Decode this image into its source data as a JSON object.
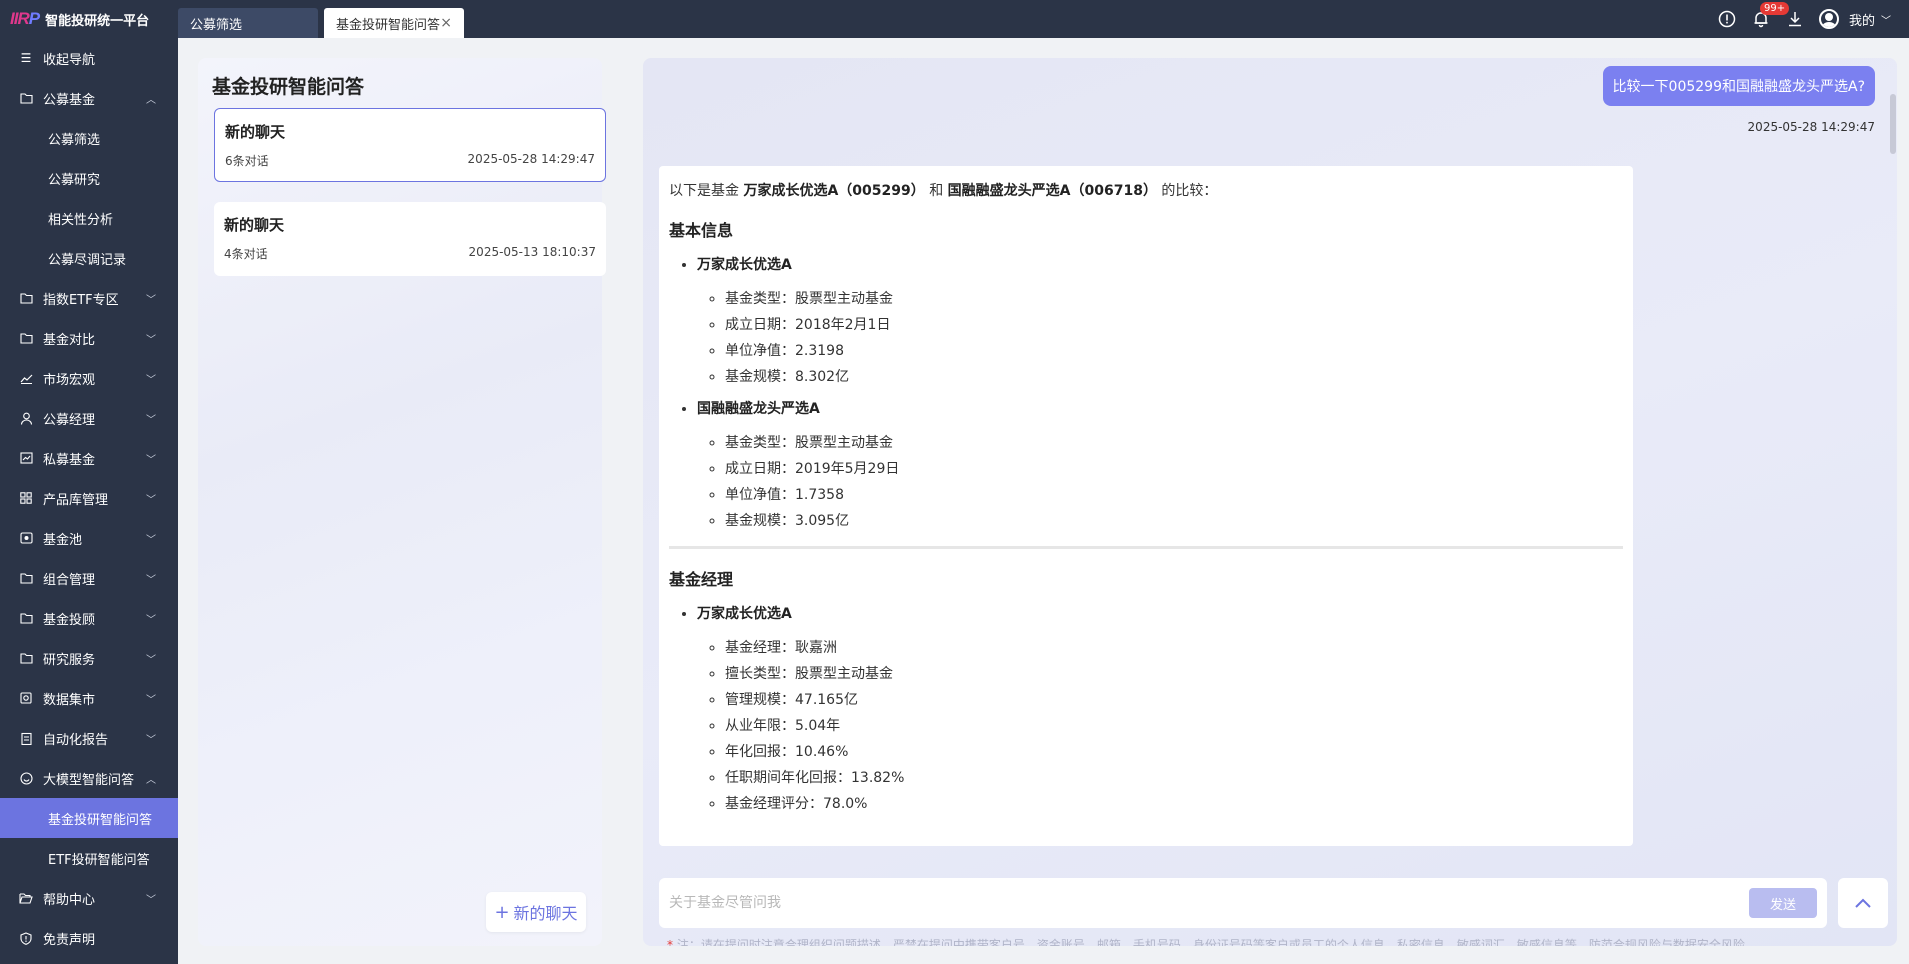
{
  "brand": {
    "logo_a": "IIR",
    "logo_b": "P",
    "title": "智能投研统一平台"
  },
  "tabs": [
    {
      "label": "公募筛选"
    },
    {
      "label": "基金投研智能问答",
      "close": "×"
    }
  ],
  "topbar": {
    "notification_badge": "99+",
    "me_label": "我的"
  },
  "sidebar": {
    "collapse": "收起导航",
    "items": [
      {
        "label": "公募基金",
        "icon": "folder-icon"
      },
      {
        "label": "公募筛选"
      },
      {
        "label": "公募研究"
      },
      {
        "label": "相关性分析"
      },
      {
        "label": "公募尽调记录"
      },
      {
        "label": "指数ETF专区",
        "icon": "folder-icon"
      },
      {
        "label": "基金对比",
        "icon": "folder-icon"
      },
      {
        "label": "市场宏观",
        "icon": "chart-line-icon"
      },
      {
        "label": "公募经理",
        "icon": "user-icon"
      },
      {
        "label": "私募基金",
        "icon": "chart-box-icon"
      },
      {
        "label": "产品库管理",
        "icon": "grid-icon"
      },
      {
        "label": "基金池",
        "icon": "pool-icon"
      },
      {
        "label": "组合管理",
        "icon": "folder-icon"
      },
      {
        "label": "基金投顾",
        "icon": "folder-icon"
      },
      {
        "label": "研究服务",
        "icon": "folder-icon"
      },
      {
        "label": "数据集市",
        "icon": "database-icon"
      },
      {
        "label": "自动化报告",
        "icon": "report-icon"
      },
      {
        "label": "大模型智能问答",
        "icon": "smile-icon"
      },
      {
        "label": "基金投研智能问答"
      },
      {
        "label": "ETF投研智能问答"
      },
      {
        "label": "帮助中心",
        "icon": "folder-open-icon"
      },
      {
        "label": "免责声明",
        "icon": "shield-icon"
      }
    ]
  },
  "left_panel": {
    "title": "基金投研智能问答",
    "chats": [
      {
        "title": "新的聊天",
        "count": "6条对话",
        "time": "2025-05-28 14:29:47"
      },
      {
        "title": "新的聊天",
        "count": "4条对话",
        "time": "2025-05-13 18:10:37"
      }
    ],
    "new_chat": "新的聊天"
  },
  "conversation": {
    "user_message": "比较一下005299和国融融盛龙头严选A?",
    "user_time": "2025-05-28 14:29:47",
    "answer": {
      "intro_prefix": "以下是基金",
      "fund_a_full": "万家成长优选A（005299）",
      "intro_and": "和",
      "fund_b_full": "国融融盛龙头严选A（006718）",
      "intro_suffix": "的比较：",
      "section_basic": "基本信息",
      "fund_a": "万家成长优选A",
      "fund_a_basic": [
        "基金类型：股票型主动基金",
        "成立日期：2018年2月1日",
        "单位净值：2.3198",
        "基金规模：8.302亿"
      ],
      "fund_b": "国融融盛龙头严选A",
      "fund_b_basic": [
        "基金类型：股票型主动基金",
        "成立日期：2019年5月29日",
        "单位净值：1.7358",
        "基金规模：3.095亿"
      ],
      "section_manager": "基金经理",
      "fund_a_manager": [
        "基金经理：耿嘉洲",
        "擅长类型：股票型主动基金",
        "管理规模：47.165亿",
        "从业年限：5.04年",
        "年化回报：10.46%",
        "任职期间年化回报：13.82%",
        "基金经理评分：78.0%"
      ]
    }
  },
  "input": {
    "placeholder": "关于基金尽管问我",
    "send": "发送",
    "notice_star": "*",
    "notice": "注：请在提问时注意合理组织问题描述，严禁在提问中携带客户号、资金账号、邮箱、手机号码、身份证号码等客户或员工的个人信息、私密信息、敏感词汇、敏感信息等，防范合规风险与数据安全风险。"
  }
}
